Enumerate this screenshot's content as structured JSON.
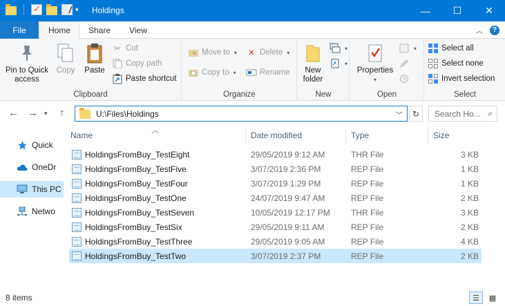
{
  "window": {
    "title": "Holdings",
    "minimize": "—",
    "maximize": "☐",
    "close": "✕"
  },
  "ribbon_tabs": {
    "file": "File",
    "home": "Home",
    "share": "Share",
    "view": "View"
  },
  "ribbon": {
    "clipboard": {
      "label": "Clipboard",
      "pin": "Pin to Quick access",
      "copy": "Copy",
      "paste": "Paste",
      "cut": "Cut",
      "copy_path": "Copy path",
      "paste_shortcut": "Paste shortcut"
    },
    "organize": {
      "label": "Organize",
      "move_to": "Move to",
      "copy_to": "Copy to",
      "delete": "Delete",
      "rename": "Rename"
    },
    "new": {
      "label": "New",
      "new_folder": "New folder"
    },
    "open": {
      "label": "Open",
      "properties": "Properties"
    },
    "select": {
      "label": "Select",
      "select_all": "Select all",
      "select_none": "Select none",
      "invert": "Invert selection"
    }
  },
  "address": {
    "path": "U:\\Files\\Holdings",
    "search_placeholder": "Search Ho..."
  },
  "nav_pane": [
    {
      "label": "Quick",
      "icon": "star-icon"
    },
    {
      "label": "OneDr",
      "icon": "cloud-icon"
    },
    {
      "label": "This PC",
      "icon": "computer-icon"
    },
    {
      "label": "Netwo",
      "icon": "network-icon"
    }
  ],
  "columns": {
    "name": "Name",
    "date": "Date modified",
    "type": "Type",
    "size": "Size"
  },
  "files": [
    {
      "name": "HoldingsFromBuy_TestEight",
      "date": "29/05/2019 9:12 AM",
      "type": "THR File",
      "size": "3 KB"
    },
    {
      "name": "HoldingsFromBuy_TestFive",
      "date": "3/07/2019 2:36 PM",
      "type": "REP File",
      "size": "1 KB"
    },
    {
      "name": "HoldingsFromBuy_TestFour",
      "date": "3/07/2019 1:29 PM",
      "type": "REP File",
      "size": "1 KB"
    },
    {
      "name": "HoldingsFromBuy_TestOne",
      "date": "24/07/2019 9:47 AM",
      "type": "REP File",
      "size": "2 KB"
    },
    {
      "name": "HoldingsFromBuy_TestSeven",
      "date": "10/05/2019 12:17 PM",
      "type": "THR File",
      "size": "3 KB"
    },
    {
      "name": "HoldingsFromBuy_TestSix",
      "date": "29/05/2019 9:11 AM",
      "type": "REP File",
      "size": "2 KB"
    },
    {
      "name": "HoldingsFromBuy_TestThree",
      "date": "29/05/2019 9:05 AM",
      "type": "REP File",
      "size": "4 KB"
    },
    {
      "name": "HoldingsFromBuy_TestTwo",
      "date": "3/07/2019 2:37 PM",
      "type": "REP File",
      "size": "2 KB"
    }
  ],
  "status": {
    "items": "8 items"
  },
  "colors": {
    "accent": "#0078d7",
    "selection": "#cce8ff"
  }
}
